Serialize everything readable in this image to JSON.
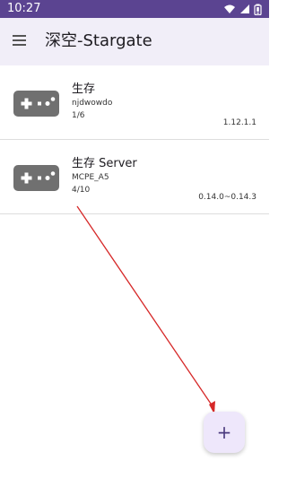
{
  "status_bar": {
    "time": "10:27",
    "icons": [
      "wifi-icon",
      "signal-icon",
      "battery-icon"
    ],
    "background_color": "#5b4491"
  },
  "app_bar": {
    "menu_icon": "menu-icon",
    "title": "深空-Stargate",
    "background_color": "#f1eef8"
  },
  "servers": [
    {
      "icon": "gamepad-icon",
      "name": "生存",
      "owner": "njdwowdo",
      "count": "1/6",
      "version": "1.12.1.1"
    },
    {
      "icon": "gamepad-icon",
      "name": "生存 Server",
      "owner": "MCPE_A5",
      "count": "4/10",
      "version": "0.14.0~0.14.3"
    }
  ],
  "fab": {
    "label": "+",
    "icon": "add-icon",
    "background_color": "#eee7fb"
  },
  "annotation": {
    "arrow_color": "#d62828",
    "arrow_icon": "red-arrow-icon"
  }
}
